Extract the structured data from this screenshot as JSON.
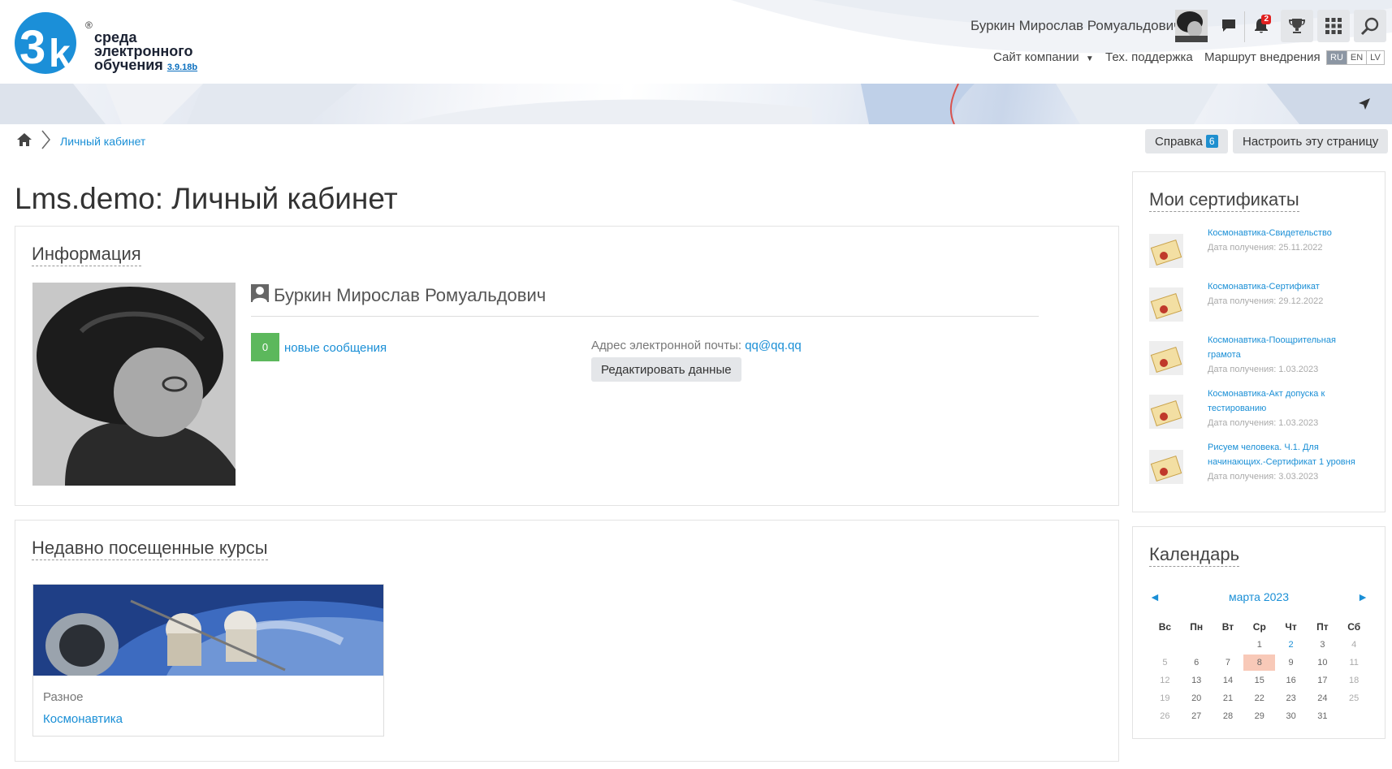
{
  "header": {
    "logo_line1": "среда",
    "logo_line2": "электронного",
    "logo_line3": "обучения",
    "logo_version": "3.9.18b",
    "logo_reg": "®",
    "user_name": "Буркин Мирослав Ромуальдович",
    "notification_count": "2",
    "nav": {
      "company_site": "Сайт компании",
      "support": "Тех. поддержка",
      "route": "Маршрут внедрения"
    },
    "languages": [
      "RU",
      "EN",
      "LV"
    ],
    "active_language": "RU"
  },
  "breadcrumb": {
    "current": "Личный кабинет"
  },
  "buttons": {
    "help_label": "Справка",
    "help_count": "6",
    "customize_label": "Настроить эту страницу"
  },
  "page_title": "Lms.demo: Личный кабинет",
  "info": {
    "title": "Информация",
    "full_name": "Буркин Мирослав Ромуальдович",
    "new_messages_count": "0",
    "new_messages_label": "новые сообщения",
    "email_label": "Адрес электронной почты:",
    "email": "qq@qq.qq",
    "edit_label": "Редактировать данные"
  },
  "recent_courses": {
    "title": "Недавно посещенные курсы",
    "items": [
      {
        "category": "Разное",
        "name": "Космонавтика"
      }
    ]
  },
  "certificates": {
    "title": "Мои сертификаты",
    "items": [
      {
        "name": "Космонавтика-Свидетельство",
        "date": "Дата получения: 25.11.2022"
      },
      {
        "name": "Космонавтика-Сертификат",
        "date": "Дата получения: 29.12.2022"
      },
      {
        "name": "Космонавтика-Поощрительная грамота",
        "date": "Дата получения: 1.03.2023"
      },
      {
        "name": "Космонавтика-Акт допуска к тестированию",
        "date": "Дата получения: 1.03.2023"
      },
      {
        "name": "Рисуем человека. Ч.1. Для начинающих.-Сертификат 1 уровня",
        "date": "Дата получения: 3.03.2023"
      }
    ]
  },
  "calendar": {
    "title": "Календарь",
    "month": "марта 2023",
    "prev": "◄",
    "next": "►",
    "weekdays": [
      "Вс",
      "Пн",
      "Вт",
      "Ср",
      "Чт",
      "Пт",
      "Сб"
    ],
    "weeks": [
      [
        "",
        "",
        "",
        "1",
        "2",
        "3",
        "4"
      ],
      [
        "5",
        "6",
        "7",
        "8",
        "9",
        "10",
        "11"
      ],
      [
        "12",
        "13",
        "14",
        "15",
        "16",
        "17",
        "18"
      ],
      [
        "19",
        "20",
        "21",
        "22",
        "23",
        "24",
        "25"
      ],
      [
        "26",
        "27",
        "28",
        "29",
        "30",
        "31",
        ""
      ]
    ],
    "today": "8",
    "event_days": [
      "2"
    ]
  },
  "colors": {
    "link": "#1a8fd6",
    "button_bg": "#e4e6e9",
    "message_badge": "#5cb85c",
    "today": "#f8c9b8",
    "notification_badge": "#e02020"
  }
}
